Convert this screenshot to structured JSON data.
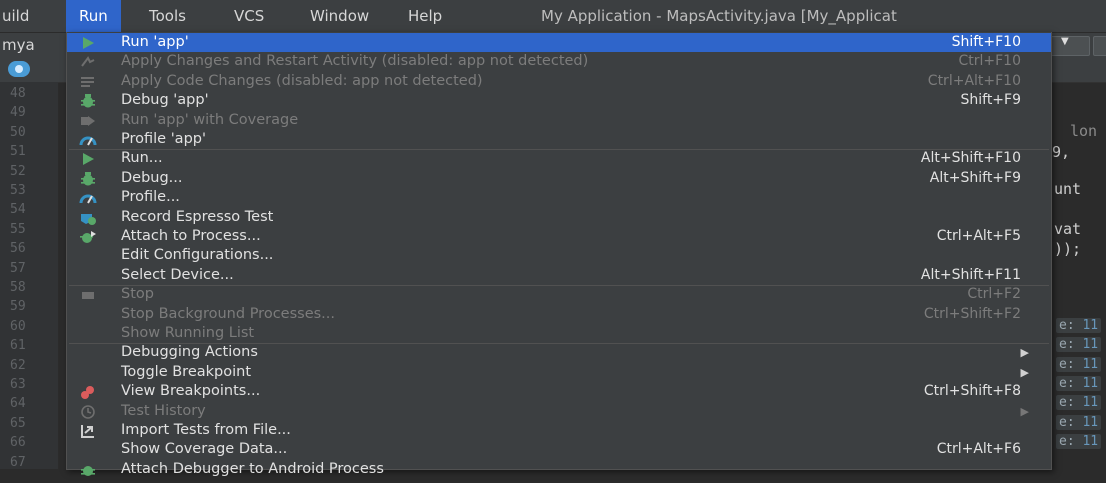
{
  "menubar": {
    "items": [
      {
        "label": "uild",
        "active": false
      },
      {
        "label": "Run",
        "active": true
      },
      {
        "label": "Tools",
        "active": false
      },
      {
        "label": "VCS",
        "active": false
      },
      {
        "label": "Window",
        "active": false
      },
      {
        "label": "Help",
        "active": false
      }
    ],
    "title": "My Application - MapsActivity.java [My_Applicat"
  },
  "toolbar": {
    "project_label": "mya"
  },
  "gutter": {
    "line_numbers": [
      "48",
      "49",
      "50",
      "51",
      "52",
      "53",
      "54",
      "55",
      "56",
      "57",
      "58",
      "59",
      "60",
      "61",
      "62",
      "63",
      "64",
      "65",
      "66",
      "67"
    ]
  },
  "code_fragments": {
    "lon": "lon",
    "nine_comma": "9,",
    "unt": "unt",
    "vat": "vat",
    "paren": "));",
    "hint_prefix": "e:",
    "hint_value": "11"
  },
  "menu": {
    "items": [
      {
        "icon": "run-icon",
        "label": "Run 'app'",
        "shortcut": "Shift+F10",
        "disabled": false,
        "selected": true
      },
      {
        "icon": "apply-changes-restart-icon",
        "label": "Apply Changes and Restart Activity (disabled: app not detected)",
        "shortcut": "Ctrl+F10",
        "disabled": true
      },
      {
        "icon": "apply-code-changes-icon",
        "label": "Apply Code Changes (disabled: app not detected)",
        "shortcut": "Ctrl+Alt+F10",
        "disabled": true
      },
      {
        "icon": "debug-icon",
        "label": "Debug 'app'",
        "shortcut": "Shift+F9",
        "disabled": false
      },
      {
        "icon": "run-coverage-icon",
        "label": "Run 'app' with Coverage",
        "shortcut": "",
        "disabled": true
      },
      {
        "icon": "profile-icon",
        "label": "Profile 'app'",
        "shortcut": "",
        "disabled": false
      },
      {
        "icon": "run-icon",
        "label": "Run...",
        "shortcut": "Alt+Shift+F10",
        "disabled": false
      },
      {
        "icon": "debug-icon",
        "label": "Debug...",
        "shortcut": "Alt+Shift+F9",
        "disabled": false
      },
      {
        "icon": "profile-icon",
        "label": "Profile...",
        "shortcut": "",
        "disabled": false
      },
      {
        "icon": "record-espresso-icon",
        "label": "Record Espresso Test",
        "shortcut": "",
        "disabled": false
      },
      {
        "icon": "attach-process-icon",
        "label": "Attach to Process...",
        "shortcut": "Ctrl+Alt+F5",
        "disabled": false
      },
      {
        "icon": "",
        "label": "Edit Configurations...",
        "shortcut": "",
        "disabled": false
      },
      {
        "icon": "",
        "label": "Select Device...",
        "shortcut": "Alt+Shift+F11",
        "disabled": false
      },
      {
        "icon": "stop-icon",
        "label": "Stop",
        "shortcut": "Ctrl+F2",
        "disabled": true
      },
      {
        "icon": "",
        "label": "Stop Background Processes...",
        "shortcut": "Ctrl+Shift+F2",
        "disabled": true
      },
      {
        "icon": "",
        "label": "Show Running List",
        "shortcut": "",
        "disabled": true
      },
      {
        "icon": "",
        "label": "Debugging Actions",
        "shortcut": "",
        "disabled": false,
        "submenu": true
      },
      {
        "icon": "",
        "label": "Toggle Breakpoint",
        "shortcut": "",
        "disabled": false,
        "submenu": true
      },
      {
        "icon": "breakpoints-icon",
        "label": "View Breakpoints...",
        "shortcut": "Ctrl+Shift+F8",
        "disabled": false
      },
      {
        "icon": "test-history-icon",
        "label": "Test History",
        "shortcut": "",
        "disabled": true,
        "submenu": true
      },
      {
        "icon": "import-tests-icon",
        "label": "Import Tests from File...",
        "shortcut": "",
        "disabled": false
      },
      {
        "icon": "",
        "label": "Show Coverage Data...",
        "shortcut": "Ctrl+Alt+F6",
        "disabled": false
      },
      {
        "icon": "attach-debugger-icon",
        "label": "Attach Debugger to Android Process",
        "shortcut": "",
        "disabled": false
      }
    ]
  },
  "colors": {
    "menu_bg": "#3c3f41",
    "selection": "#2f65ca",
    "run_green": "#59a869",
    "profile_blue": "#3592c4",
    "breakpoint_red": "#db5c5c"
  }
}
